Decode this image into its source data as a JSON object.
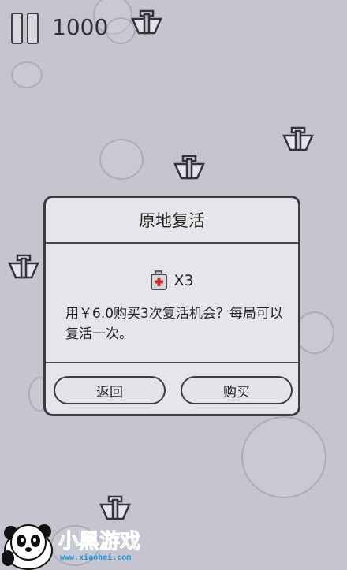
{
  "hud": {
    "score": "1000",
    "pause_icon": "pause-icon"
  },
  "dialog": {
    "title": "原地复活",
    "item_icon": "medkit-icon",
    "item_count": "X3",
    "description": "用￥6.0购买3次复活机会？每局可以复活一次。",
    "back_label": "返回",
    "buy_label": "购买"
  },
  "watermark": {
    "brand": "小黑游戏",
    "url": "www.xiaohei.com",
    "mascot_icon": "panda-mascot-icon"
  },
  "colors": {
    "background": "#c4c5ce",
    "dialog_bg": "#e6e6ea",
    "outline": "#3c3c44",
    "brand_blue": "#1f93e0"
  }
}
